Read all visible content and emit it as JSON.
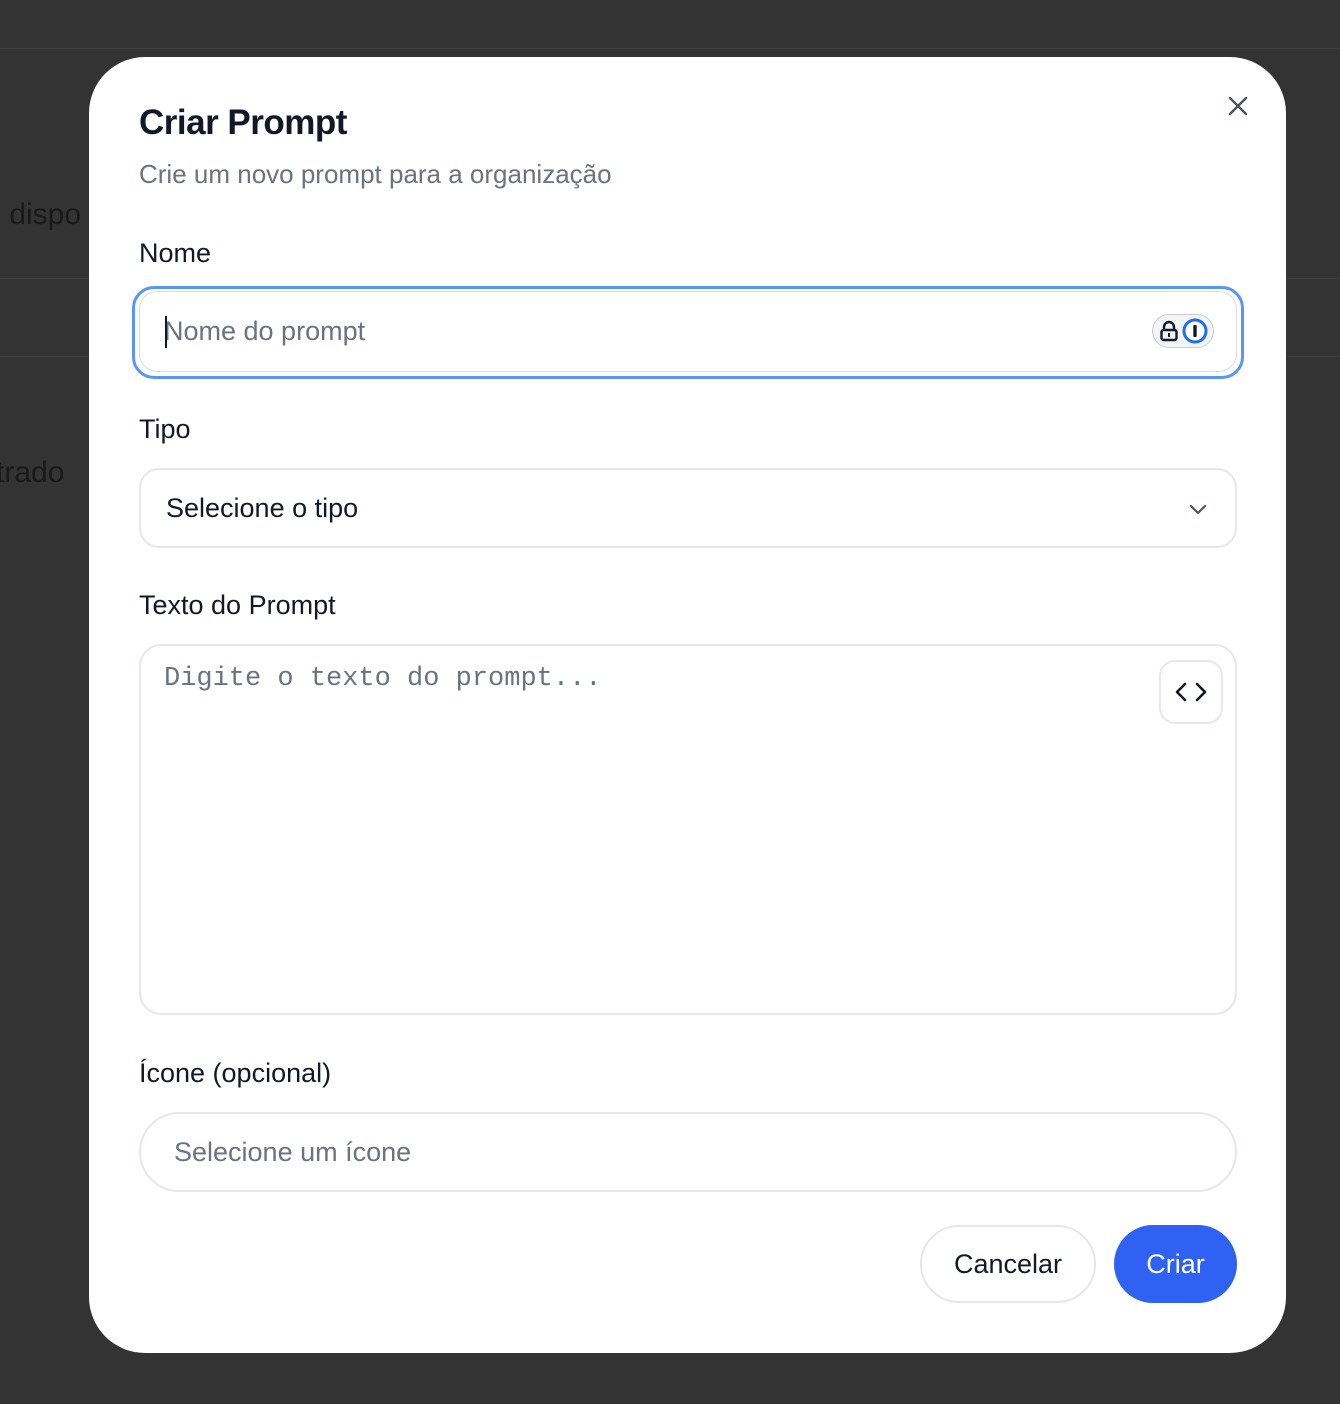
{
  "background": {
    "fragments": [
      "s dispo",
      "trado"
    ]
  },
  "dialog": {
    "title": "Criar Prompt",
    "subtitle": "Crie um novo prompt para a organização",
    "close_icon": "close-icon"
  },
  "form": {
    "name": {
      "label": "Nome",
      "placeholder": "Nome do prompt",
      "value": "",
      "focused": true,
      "addon_icon": "password-manager-icon"
    },
    "type": {
      "label": "Tipo",
      "selected": "Selecione o tipo",
      "icon": "chevron-down-icon"
    },
    "text": {
      "label": "Texto do Prompt",
      "placeholder": "Digite o texto do prompt...",
      "value": "",
      "toggle_icon": "code-icon"
    },
    "icon": {
      "label": "Ícone (opcional)",
      "selected": "Selecione um ícone"
    }
  },
  "actions": {
    "cancel_label": "Cancelar",
    "create_label": "Criar"
  },
  "colors": {
    "backdrop": "#333333",
    "accent": "#2f62f2",
    "focus_ring": "#3b82f6",
    "text_primary": "#111827",
    "text_muted": "#6b7280"
  }
}
